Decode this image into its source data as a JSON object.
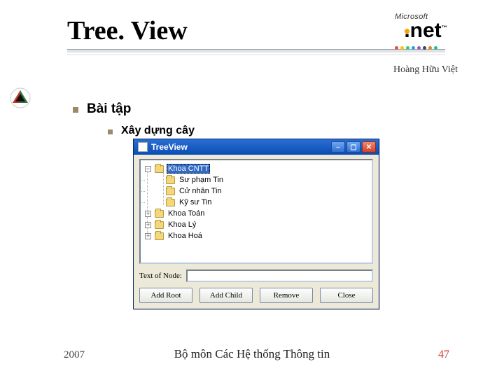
{
  "title": "Tree. View",
  "author": "Hoàng Hữu Việt",
  "logo": {
    "brand": "Microsoft",
    "product": ".net"
  },
  "bullets": {
    "level1": "Bài tập",
    "level2": "Xây dựng cây"
  },
  "winform": {
    "title": "TreeView",
    "tree": {
      "root_expanded": {
        "label": "Khoa CNTT",
        "selected": true,
        "pm": "−"
      },
      "children": [
        {
          "label": "Sư phạm Tin"
        },
        {
          "label": "Cử nhân Tin"
        },
        {
          "label": "Kỹ sư Tin"
        }
      ],
      "siblings": [
        {
          "label": "Khoa Toán",
          "pm": "+"
        },
        {
          "label": "Khoa Lý",
          "pm": "+"
        },
        {
          "label": "Khoa Hoá",
          "pm": "+"
        }
      ]
    },
    "text_of_node_label": "Text of Node:",
    "text_of_node_value": "",
    "buttons": {
      "add_root": "Add Root",
      "add_child": "Add Child",
      "remove": "Remove",
      "close": "Close"
    }
  },
  "footer": {
    "year": "2007",
    "department": "Bộ môn Các Hệ thống Thông tin",
    "page": "47"
  }
}
